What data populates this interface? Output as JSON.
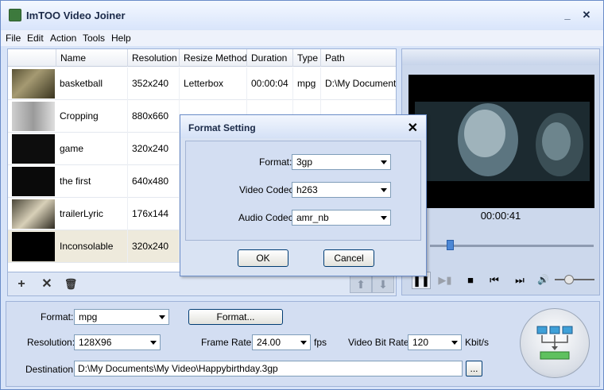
{
  "window": {
    "title": "ImTOO Video Joiner",
    "minimize": "_",
    "close": "✕"
  },
  "menu": [
    "File",
    "Edit",
    "Action",
    "Tools",
    "Help"
  ],
  "columns": [
    "Name",
    "Resolution",
    "Resize Method",
    "Duration",
    "Type",
    "Path"
  ],
  "rows": [
    {
      "name": "basketball",
      "resolution": "352x240",
      "resize": "Letterbox",
      "duration": "00:00:04",
      "type": "mpg",
      "path": "D:\\My Documents\\"
    },
    {
      "name": "Cropping",
      "resolution": "880x660",
      "resize": "",
      "duration": "",
      "type": "",
      "path": ""
    },
    {
      "name": "game",
      "resolution": "320x240",
      "resize": "",
      "duration": "",
      "type": "",
      "path": ""
    },
    {
      "name": "the first",
      "resolution": "640x480",
      "resize": "",
      "duration": "",
      "type": "",
      "path": ""
    },
    {
      "name": "trailerLyric",
      "resolution": "176x144",
      "resize": "",
      "duration": "",
      "type": "",
      "path": ""
    },
    {
      "name": "Inconsolable",
      "resolution": "320x240",
      "resize": "",
      "duration": "",
      "type": "",
      "path": ""
    }
  ],
  "list_toolbar": {
    "add": "+",
    "remove": "✕",
    "delete": "🗑",
    "up": "⬆",
    "down": "⬇"
  },
  "preview": {
    "time": "00:00:41",
    "seek_fraction": 0.12,
    "volume_fraction": 0.35,
    "controls": {
      "pause": "❚❚",
      "step": "▶▮",
      "stop": "■",
      "prev": "⏮",
      "next": "⏭",
      "volume": "🔊"
    }
  },
  "settings": {
    "format_label": "Format:",
    "format_value": "mpg",
    "format_button": "Format...",
    "resolution_label": "Resolution:",
    "resolution_value": "128X96",
    "framerate_label": "Frame Rate:",
    "framerate_value": "24.00",
    "framerate_unit": "fps",
    "bitrate_label": "Video Bit Rate:",
    "bitrate_value": "120",
    "bitrate_unit": "Kbit/s",
    "destination_label": "Destination:",
    "destination_value": "D:\\My Documents\\My Video\\Happybirthday.3gp",
    "browse_button": "..."
  },
  "dialog": {
    "title": "Format Setting",
    "close": "✕",
    "format_label": "Format:",
    "format_value": "3gp",
    "video_codec_label": "Video Codec:",
    "video_codec_value": "h263",
    "audio_codec_label": "Audio Codec:",
    "audio_codec_value": "amr_nb",
    "ok": "OK",
    "cancel": "Cancel"
  },
  "colors": {
    "accent": "#4d88d6",
    "window_bg": "#d8e4f8",
    "selected_row": "#eeeadc"
  }
}
